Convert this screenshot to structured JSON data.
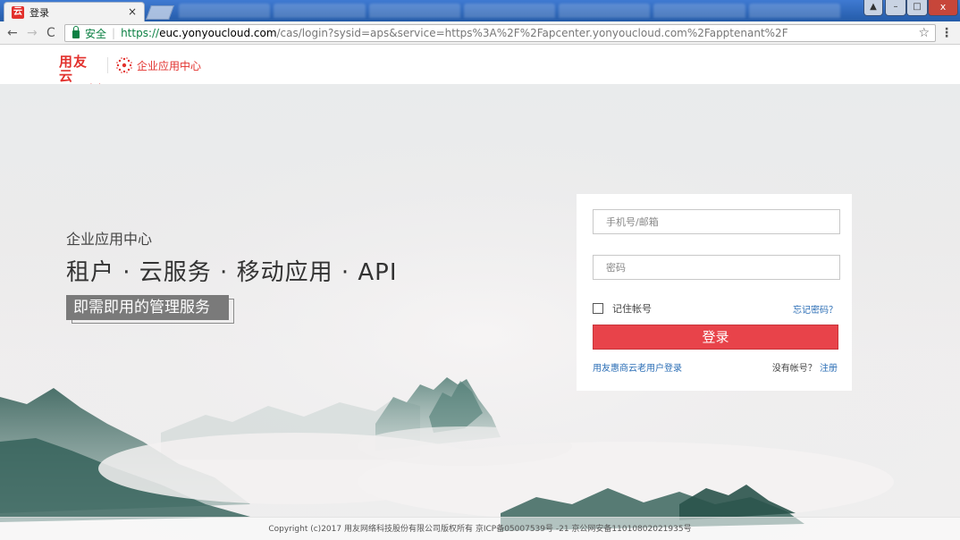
{
  "browser": {
    "tab_title": "登录",
    "tab_close": "×",
    "secure_label": "安全",
    "url_scheme": "https://",
    "url_host": "euc.yonyoucloud.com",
    "url_rest": "/cas/login?sysid=aps&service=https%3A%2F%2Fapcenter.yonyoucloud.com%2Fapptenant%2F",
    "back_icon": "←",
    "forward_icon": "→",
    "reload_icon": "C",
    "star_icon": "☆",
    "menu_icon": "⋮",
    "close_icon": "x"
  },
  "header": {
    "brand_name": "用友云",
    "brand_sub": "yonyoucloud",
    "app_name": "企业应用中心"
  },
  "hero": {
    "kicker": "企业应用中心",
    "headline": "租户 · 云服务 · 移动应用 · API",
    "tag": "即需即用的管理服务"
  },
  "login": {
    "username_placeholder": "手机号/邮箱",
    "password_placeholder": "密码",
    "remember_label": "记住帐号",
    "forgot_label": "忘记密码？",
    "submit_label": "登录",
    "legacy_link": "用友惠商云老用户登录",
    "no_account_label": "没有帐号？",
    "register_label": "注册"
  },
  "footer": {
    "copyright": "Copyright (c)2017 用友网络科技股份有限公司版权所有 京ICP备05007539号 -21 京公网安备11010802021935号"
  },
  "colors": {
    "brand_red": "#e2312d",
    "button_red": "#e8434a",
    "link_blue": "#2d6fb6",
    "secure_green": "#0b8043"
  }
}
